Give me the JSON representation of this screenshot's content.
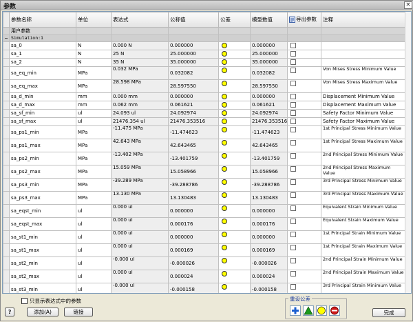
{
  "window": {
    "title": "参数",
    "close": "×"
  },
  "header": {
    "name": "参数名称",
    "unit": "单位",
    "expr": "表达式",
    "nominal": "公称值",
    "tol": "公差",
    "model": "模型数值",
    "export": "导出参数",
    "comment": "注释"
  },
  "groups": {
    "user": "用户参数",
    "sim": "Simulation:1"
  },
  "rows": [
    {
      "name": "sa_0",
      "unit": "N",
      "expr": "0.000 N",
      "nominal": "0.000000",
      "model": "0.000000",
      "comment": ""
    },
    {
      "name": "sa_1",
      "unit": "N",
      "expr": "25 N",
      "nominal": "25.000000",
      "model": "25.000000",
      "comment": ""
    },
    {
      "name": "sa_2",
      "unit": "N",
      "expr": "35 N",
      "nominal": "35.000000",
      "model": "35.000000",
      "comment": ""
    },
    {
      "name": "sa_eq_min",
      "unit": "MPa",
      "expr": "0.032 MPa",
      "nominal": "0.032082",
      "model": "0.032082",
      "comment": "Von Mises Stress Minimum Value"
    },
    {
      "name": "sa_eq_max",
      "unit": "MPa",
      "expr": "28.598 MPa",
      "nominal": "28.597550",
      "model": "28.597550",
      "comment": "Von Mises Stress Maximum Value"
    },
    {
      "name": "sa_d_min",
      "unit": "mm",
      "expr": "0.000 mm",
      "nominal": "0.000000",
      "model": "0.000000",
      "comment": "Displacement Minimum Value"
    },
    {
      "name": "sa_d_max",
      "unit": "mm",
      "expr": "0.062 mm",
      "nominal": "0.061621",
      "model": "0.061621",
      "comment": "Displacement Maximum Value"
    },
    {
      "name": "sa_sf_min",
      "unit": "ul",
      "expr": "24.093 ul",
      "nominal": "24.092974",
      "model": "24.092974",
      "comment": "Safety Factor Minimum Value"
    },
    {
      "name": "sa_sf_max",
      "unit": "ul",
      "expr": "21476.354 ul",
      "nominal": "21476.353516",
      "model": "21476.353516",
      "comment": "Safety Factor Maximum Value"
    },
    {
      "name": "sa_ps1_min",
      "unit": "MPa",
      "expr": "-11.475 MPa",
      "nominal": "-11.474623",
      "model": "-11.474623",
      "comment": "1st Principal Stress Minimum Value"
    },
    {
      "name": "sa_ps1_max",
      "unit": "MPa",
      "expr": "42.643 MPa",
      "nominal": "42.643465",
      "model": "42.643465",
      "comment": "1st Principal Stress Maximum Value"
    },
    {
      "name": "sa_ps2_min",
      "unit": "MPa",
      "expr": "-13.402 MPa",
      "nominal": "-13.401759",
      "model": "-13.401759",
      "comment": "2nd Principal Stress Minimum Value"
    },
    {
      "name": "sa_ps2_max",
      "unit": "MPa",
      "expr": "15.059 MPa",
      "nominal": "15.058966",
      "model": "15.058966",
      "comment": "2nd Principal Stress Maximum Value"
    },
    {
      "name": "sa_ps3_min",
      "unit": "MPa",
      "expr": "-39.289 MPa",
      "nominal": "-39.288786",
      "model": "-39.288786",
      "comment": "3rd Principal Stress Minimum Value"
    },
    {
      "name": "sa_ps3_max",
      "unit": "MPa",
      "expr": "13.130 MPa",
      "nominal": "13.130483",
      "model": "13.130483",
      "comment": "3rd Principal Stress Maximum Value"
    },
    {
      "name": "sa_eqst_min",
      "unit": "ul",
      "expr": "0.000 ul",
      "nominal": "0.000000",
      "model": "0.000000",
      "comment": "Equivalent Strain Minimum Value"
    },
    {
      "name": "sa_eqst_max",
      "unit": "ul",
      "expr": "0.000 ul",
      "nominal": "0.000176",
      "model": "0.000176",
      "comment": "Equivalent Strain Maximum Value"
    },
    {
      "name": "sa_st1_min",
      "unit": "ul",
      "expr": "0.000 ul",
      "nominal": "0.000000",
      "model": "0.000000",
      "comment": "1st Principal Strain Minimum Value"
    },
    {
      "name": "sa_st1_max",
      "unit": "ul",
      "expr": "0.000 ul",
      "nominal": "0.000169",
      "model": "0.000169",
      "comment": "1st Principal Strain Maximum Value"
    },
    {
      "name": "sa_st2_min",
      "unit": "ul",
      "expr": "-0.000 ul",
      "nominal": "-0.000026",
      "model": "-0.000026",
      "comment": "2nd Principal Strain Minimum Value"
    },
    {
      "name": "sa_st2_max",
      "unit": "ul",
      "expr": "0.000 ul",
      "nominal": "0.000024",
      "model": "0.000024",
      "comment": "2nd Principal Strain Maximum Value"
    },
    {
      "name": "sa_st3_min",
      "unit": "ul",
      "expr": "-0.000 ul",
      "nominal": "-0.000158",
      "model": "-0.000158",
      "comment": "3rd Principal Strain Minimum Value"
    }
  ],
  "bottom": {
    "filter": "只显示表达式中的参数",
    "add": "添加(A)",
    "link": "链接",
    "preset": "重设公差",
    "done": "完成",
    "help": "?"
  },
  "colors": {
    "tol_indicator": "#ffff00",
    "preset_plus": "#1a5fd0",
    "preset_tri": "#1a9a1a",
    "preset_circ": "#ffff00",
    "preset_minus": "#d01a1a"
  },
  "icons": {
    "export": "export-parameter-icon"
  }
}
